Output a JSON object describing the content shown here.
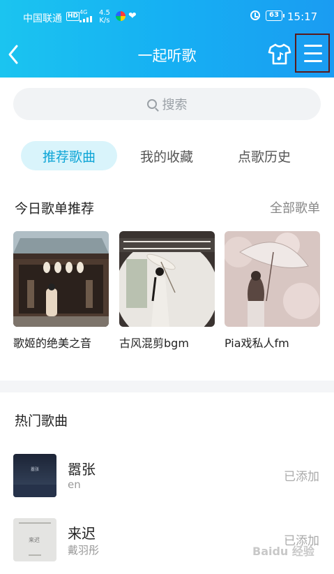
{
  "status_bar": {
    "carrier": "中国联通",
    "hd": "HD",
    "network": "4G",
    "speed_value": "4.5",
    "speed_unit": "K/s",
    "battery": "63",
    "time": "15:17"
  },
  "header": {
    "title": "一起听歌"
  },
  "search": {
    "placeholder": "搜索"
  },
  "tabs": [
    {
      "label": "推荐歌曲",
      "active": true
    },
    {
      "label": "我的收藏",
      "active": false
    },
    {
      "label": "点歌历史",
      "active": false
    }
  ],
  "recommend": {
    "title": "今日歌单推荐",
    "more": "全部歌单",
    "playlists": [
      {
        "name": "歌姬的绝美之音"
      },
      {
        "name": "古风混剪bgm"
      },
      {
        "name": "Pia戏私人fm"
      }
    ]
  },
  "hot": {
    "title": "热门歌曲",
    "songs": [
      {
        "title": "嚣张",
        "artist": "en",
        "status": "已添加",
        "art_text": "嚣张"
      },
      {
        "title": "来迟",
        "artist": "戴羽彤",
        "status": "已添加",
        "art_text": "来迟"
      }
    ]
  },
  "watermark": "Baidu 经验",
  "colors": {
    "header_start": "#1bc4f0",
    "header_end": "#1a9cf2",
    "accent": "#0ea5d6",
    "active_tab_bg": "#d9f4fb"
  }
}
